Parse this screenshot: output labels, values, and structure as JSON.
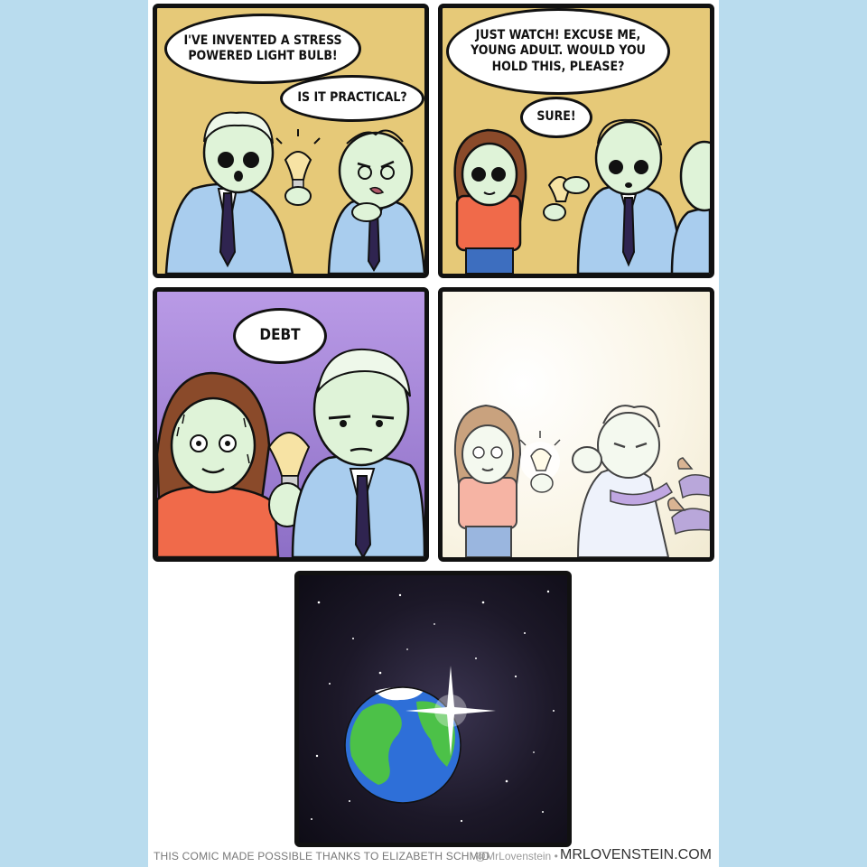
{
  "panels": [
    {
      "bubbles": [
        "I'VE INVENTED A STRESS POWERED LIGHT BULB!",
        "IS IT PRACTICAL?"
      ]
    },
    {
      "bubbles": [
        "JUST WATCH! EXCUSE ME, YOUNG ADULT. WOULD YOU HOLD THIS, PLEASE?",
        "SURE!"
      ]
    },
    {
      "bubbles": [
        "DEBT"
      ]
    },
    {
      "bubbles": []
    },
    {
      "bubbles": []
    }
  ],
  "footer": {
    "credit": "THIS COMIC MADE POSSIBLE THANKS TO ELIZABETH SCHMID",
    "handle": "@MrLovenstein",
    "separator": "•",
    "site": "MRLOVENSTEIN.COM"
  },
  "colors": {
    "background": "#b9dcee",
    "panel_yellow": "#e6c978",
    "panel_purple": "#a98ad8",
    "lab_coat": "#a9cdee",
    "skin": "#dff3d8",
    "hair_brown": "#8a4a2a",
    "shirt_orange": "#f06a4a",
    "space": "#141220"
  }
}
